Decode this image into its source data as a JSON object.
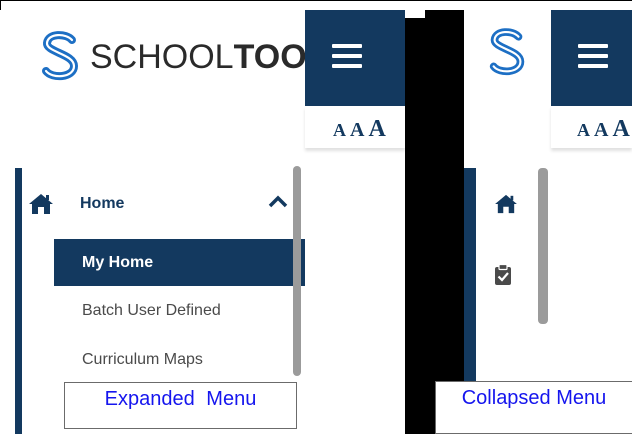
{
  "brand": {
    "logo_light": "SCHOOL",
    "logo_bold": "TOOL"
  },
  "expanded": {
    "nav": {
      "home_label": "Home",
      "items": [
        {
          "label": "My Home",
          "active": true
        },
        {
          "label": "Batch User Defined",
          "active": false
        },
        {
          "label": "Curriculum Maps",
          "active": false
        }
      ]
    },
    "font_sizes": [
      "A",
      "A",
      "A"
    ],
    "caption": "Expanded Menu"
  },
  "collapsed": {
    "font_sizes": [
      "A",
      "A",
      "A"
    ],
    "caption": "Collapsed Menu"
  },
  "colors": {
    "navy": "#13395f",
    "logo_blue": "#1d6fc4",
    "caption_text": "#1515ee",
    "scrollbar": "#9b9b9b"
  },
  "icons": {
    "menu": "hamburger-icon",
    "home": "home-icon",
    "expand": "chevron-up-icon",
    "task": "clipboard-check-icon"
  }
}
